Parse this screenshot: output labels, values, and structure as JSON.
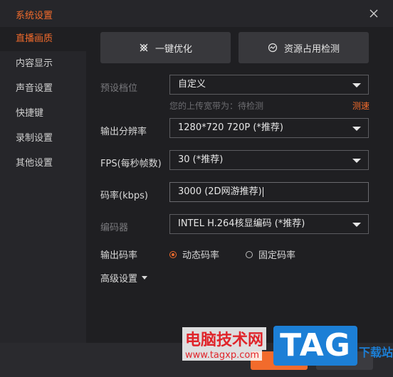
{
  "window": {
    "title": "系统设置"
  },
  "sidebar": {
    "items": [
      {
        "label": "直播画质",
        "active": true
      },
      {
        "label": "内容显示",
        "active": false
      },
      {
        "label": "声音设置",
        "active": false
      },
      {
        "label": "快捷键",
        "active": false
      },
      {
        "label": "录制设置",
        "active": false
      },
      {
        "label": "其他设置",
        "active": false
      }
    ]
  },
  "actions": {
    "optimize_label": "一键优化",
    "resource_check_label": "资源占用检测"
  },
  "form": {
    "preset": {
      "label": "预设档位",
      "value": "自定义"
    },
    "bandwidth": {
      "hint": "您的上传宽带为：待检测",
      "speed_test_label": "测速"
    },
    "resolution": {
      "label": "输出分辨率",
      "value": "1280*720 720P (*推荐)"
    },
    "fps": {
      "label": "FPS(每秒帧数)",
      "value": "30 (*推荐)"
    },
    "bitrate": {
      "label": "码率(kbps)",
      "value": "3000 (2D网游推荐)"
    },
    "encoder": {
      "label": "编码器",
      "value": "INTEL H.264核显编码 (*推荐)"
    },
    "output_bitrate": {
      "label": "输出码率",
      "options": [
        {
          "label": "动态码率",
          "checked": true
        },
        {
          "label": "固定码率",
          "checked": false
        }
      ]
    },
    "advanced_label": "高级设置"
  },
  "watermark": {
    "cn": "电脑技术网",
    "url": "www.tagxp.com",
    "logo": "TAG",
    "right_text": "下载站"
  },
  "colors": {
    "accent": "#f26b2c",
    "background": "#1f1f22",
    "sidebar": "#26262a"
  }
}
